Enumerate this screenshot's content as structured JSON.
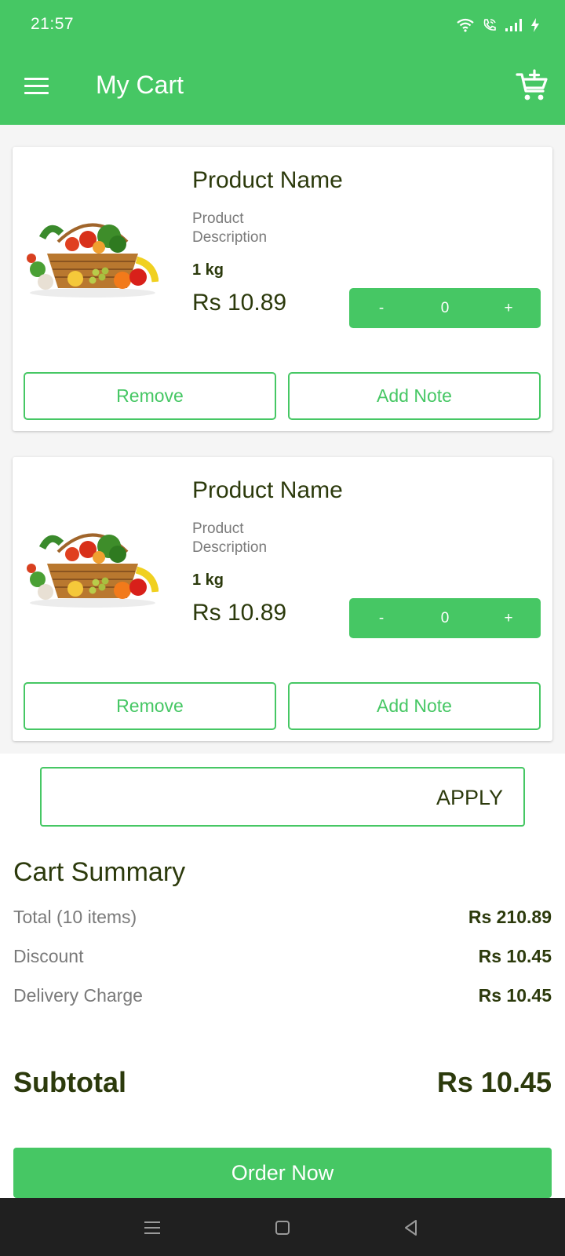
{
  "status_bar": {
    "time": "21:57",
    "icons": [
      "wifi-icon",
      "wifi-call-icon",
      "signal-icon",
      "charging-icon"
    ]
  },
  "app_bar": {
    "title": "My Cart",
    "left_icon": "hamburger-menu-icon",
    "right_icon": "add-to-cart-icon"
  },
  "cart_items": [
    {
      "name": "Product Name",
      "description": "Product Description",
      "weight": "1 kg",
      "price": "Rs 10.89",
      "quantity": "0",
      "decrement_label": "-",
      "increment_label": "+",
      "remove_label": "Remove",
      "note_label": "Add Note"
    },
    {
      "name": "Product Name",
      "description": "Product Description",
      "weight": "1 kg",
      "price": "Rs 10.89",
      "quantity": "0",
      "decrement_label": "-",
      "increment_label": "+",
      "remove_label": "Remove",
      "note_label": "Add Note"
    }
  ],
  "coupon": {
    "value": "",
    "apply_label": "APPLY"
  },
  "summary": {
    "title": "Cart Summary",
    "rows": [
      {
        "label": "Total (10 items)",
        "value": "Rs 210.89"
      },
      {
        "label": "Discount",
        "value": "Rs 10.45"
      },
      {
        "label": "Delivery Charge",
        "value": "Rs 10.45"
      }
    ],
    "subtotal_label": "Subtotal",
    "subtotal_value": "Rs 10.45"
  },
  "order_button": "Order Now",
  "nav_bar": {
    "icons": [
      "recents-icon",
      "home-icon",
      "back-icon"
    ]
  },
  "colors": {
    "accent": "#46c764",
    "text_dark": "#2c3a0c",
    "text_muted": "#7a7a7a",
    "nav_bg": "#202020"
  }
}
